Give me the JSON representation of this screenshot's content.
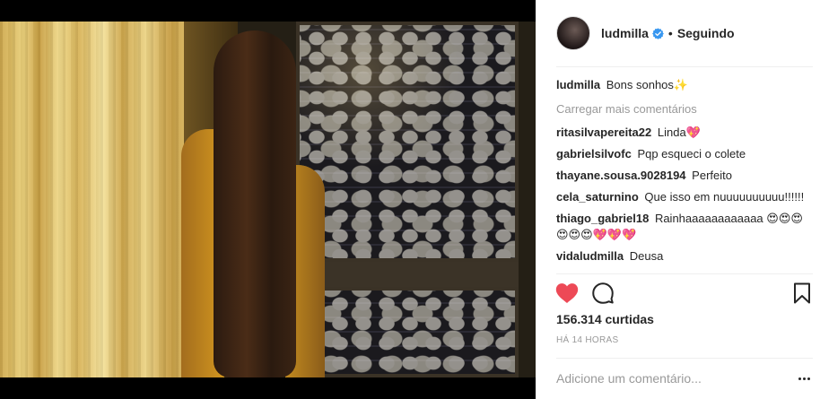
{
  "post": {
    "author": "ludmilla",
    "verified": true,
    "separator": "•",
    "follow_status": "Seguindo",
    "caption": {
      "user": "ludmilla",
      "text": "Bons sonhos✨"
    },
    "load_more_label": "Carregar mais comentários",
    "comments": [
      {
        "user": "ritasilvapereita22",
        "text": "Linda💖"
      },
      {
        "user": "gabrielsilvofc",
        "text": "Pqp esqueci o colete"
      },
      {
        "user": "thayane.sousa.9028194",
        "text": "Perfeito"
      },
      {
        "user": "cela_saturnino",
        "text": "Que isso em nuuuuuuuuuu!!!!!!"
      },
      {
        "user": "thiago_gabriel18",
        "text": "Rainhaaaaaaaaaaaa ⁭⁭😍😍😍😍😍😍💖💖💖"
      },
      {
        "user": "vidaludmilla",
        "text": "Deusa"
      }
    ],
    "likes": "156.314 curtidas",
    "timestamp": "HÁ 14 HORAS",
    "add_comment_placeholder": "Adicione um comentário...",
    "icons": {
      "like": "heart-filled-icon",
      "comment": "comment-bubble-icon",
      "save": "bookmark-icon",
      "more": "more-options-icon",
      "verified": "verified-badge-icon"
    },
    "colors": {
      "like_red": "#ed4956",
      "verified_blue": "#3897f0",
      "muted_text": "#999999"
    }
  }
}
